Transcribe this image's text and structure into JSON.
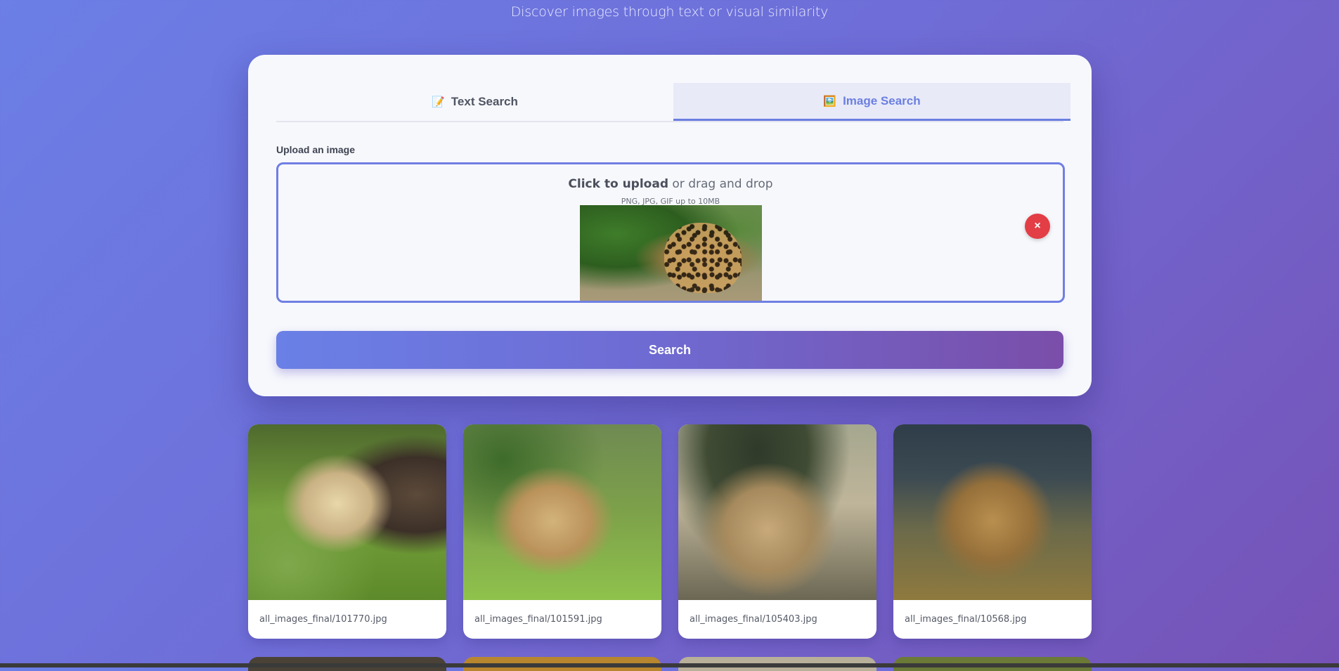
{
  "header": {
    "subtitle": "Discover images through text or visual similarity"
  },
  "tabs": [
    {
      "label": "Text Search",
      "icon": "memo-icon",
      "active": false
    },
    {
      "label": "Image Search",
      "icon": "picture-icon",
      "active": true
    }
  ],
  "upload": {
    "label": "Upload an image",
    "cta_bold": "Click to upload",
    "cta_rest": " or drag and drop",
    "hint": "PNG, JPG, GIF up to 10MB",
    "remove_symbol": "×"
  },
  "search_button": {
    "label": "Search"
  },
  "results": [
    {
      "caption": "all_images_final/101770.jpg"
    },
    {
      "caption": "all_images_final/101591.jpg"
    },
    {
      "caption": "all_images_final/105403.jpg"
    },
    {
      "caption": "all_images_final/10568.jpg"
    }
  ],
  "colors": {
    "accent": "#6b7fe0",
    "remove": "#e33d45",
    "background_start": "#6b7fe6",
    "background_end": "#7652b6"
  }
}
